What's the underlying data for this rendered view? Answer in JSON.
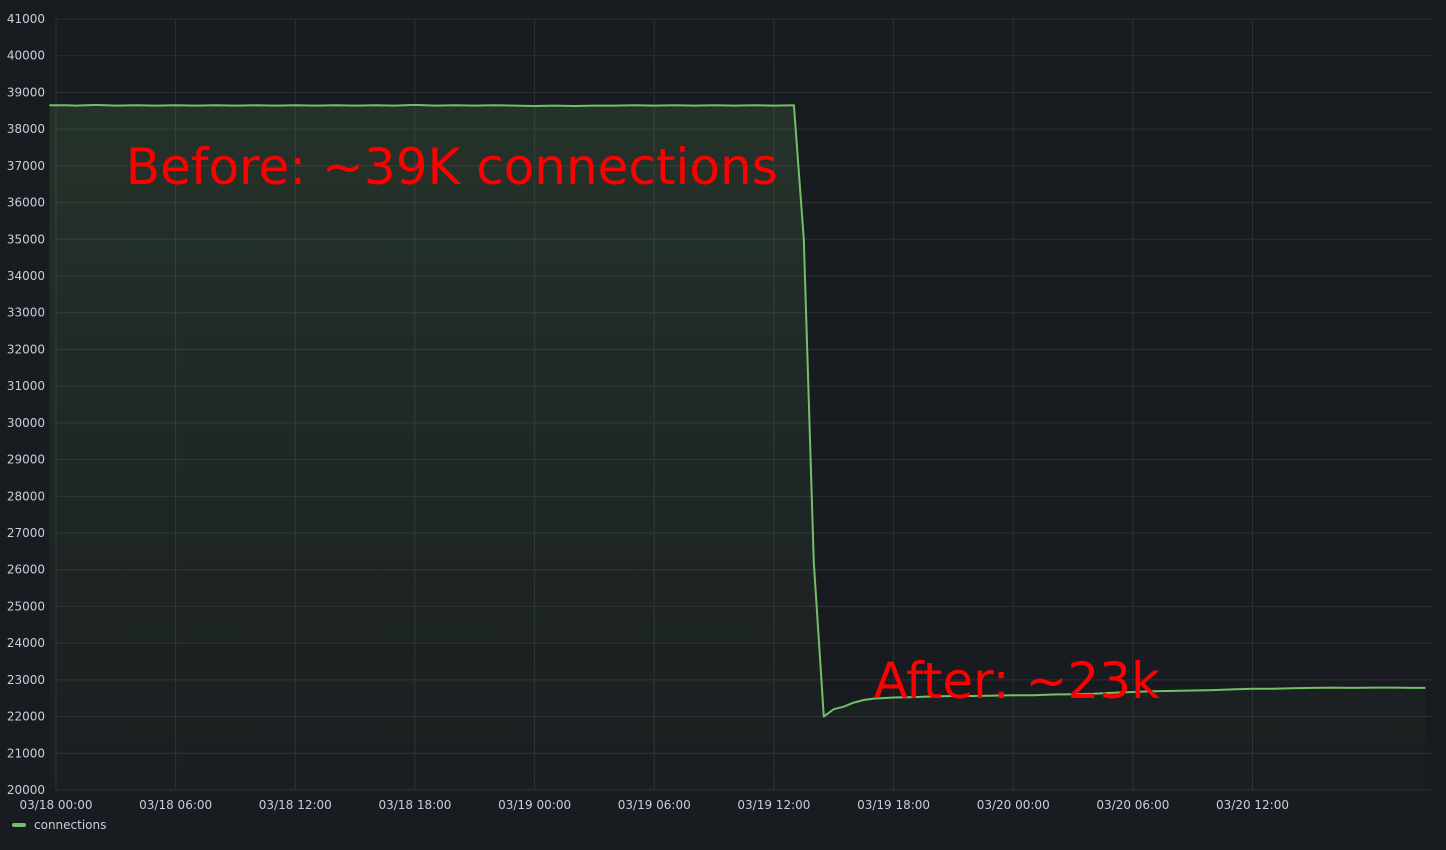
{
  "chart_data": {
    "type": "area",
    "title": "",
    "xlabel": "",
    "ylabel": "",
    "ylim": [
      20000,
      41000
    ],
    "yticks": [
      20000,
      21000,
      22000,
      23000,
      24000,
      25000,
      26000,
      27000,
      28000,
      29000,
      30000,
      31000,
      32000,
      33000,
      34000,
      35000,
      36000,
      37000,
      38000,
      39000,
      40000,
      41000
    ],
    "xlim": [
      "03/18 00:00",
      "03/20 21:00"
    ],
    "xticks": [
      "03/18 00:00",
      "03/18 06:00",
      "03/18 12:00",
      "03/18 18:00",
      "03/19 00:00",
      "03/19 06:00",
      "03/19 12:00",
      "03/19 18:00",
      "03/20 00:00",
      "03/20 06:00",
      "03/20 12:00"
    ],
    "grid": true,
    "legend_position": "bottom-left",
    "series": [
      {
        "name": "connections",
        "color": "#73bf69",
        "x": [
          "03/17 23:40",
          "03/18 00:30",
          "03/18 01:00",
          "03/18 02:00",
          "03/18 03:00",
          "03/18 04:00",
          "03/18 05:00",
          "03/18 06:00",
          "03/18 07:00",
          "03/18 08:00",
          "03/18 09:00",
          "03/18 10:00",
          "03/18 11:00",
          "03/18 12:00",
          "03/18 13:00",
          "03/18 14:00",
          "03/18 15:00",
          "03/18 16:00",
          "03/18 17:00",
          "03/18 18:00",
          "03/18 19:00",
          "03/18 20:00",
          "03/18 21:00",
          "03/18 22:00",
          "03/18 23:00",
          "03/19 00:00",
          "03/19 01:00",
          "03/19 02:00",
          "03/19 03:00",
          "03/19 04:00",
          "03/19 05:00",
          "03/19 06:00",
          "03/19 07:00",
          "03/19 08:00",
          "03/19 09:00",
          "03/19 10:00",
          "03/19 11:00",
          "03/19 12:00",
          "03/19 13:00",
          "03/19 13:30",
          "03/19 14:00",
          "03/19 14:30",
          "03/19 15:00",
          "03/19 15:30",
          "03/19 16:00",
          "03/19 16:30",
          "03/19 17:00",
          "03/19 18:00",
          "03/19 19:00",
          "03/19 20:00",
          "03/19 21:00",
          "03/19 22:00",
          "03/19 23:00",
          "03/20 00:00",
          "03/20 01:00",
          "03/20 02:00",
          "03/20 03:00",
          "03/20 04:00",
          "03/20 05:00",
          "03/20 06:00",
          "03/20 07:00",
          "03/20 08:00",
          "03/20 09:00",
          "03/20 10:00",
          "03/20 11:00",
          "03/20 12:00",
          "03/20 13:00",
          "03/20 14:00",
          "03/20 15:00",
          "03/20 16:00",
          "03/20 17:00",
          "03/20 18:00",
          "03/20 19:00",
          "03/20 20:00",
          "03/20 20:40"
        ],
        "values": [
          38650,
          38650,
          38640,
          38660,
          38640,
          38650,
          38640,
          38650,
          38640,
          38650,
          38640,
          38650,
          38640,
          38650,
          38640,
          38650,
          38640,
          38650,
          38640,
          38660,
          38640,
          38650,
          38640,
          38650,
          38640,
          38630,
          38640,
          38630,
          38640,
          38640,
          38650,
          38640,
          38650,
          38640,
          38650,
          38640,
          38650,
          38640,
          38650,
          35000,
          26200,
          22000,
          22200,
          22270,
          22380,
          22450,
          22490,
          22520,
          22530,
          22550,
          22560,
          22560,
          22570,
          22580,
          22580,
          22600,
          22610,
          22620,
          22650,
          22670,
          22690,
          22700,
          22710,
          22720,
          22740,
          22760,
          22760,
          22770,
          22780,
          22790,
          22780,
          22790,
          22790,
          22780,
          22780
        ]
      }
    ],
    "annotations": [
      {
        "text": "Before: ~39K connections",
        "x": "03/18 03:30",
        "y": 37000
      },
      {
        "text": "After: ~23k",
        "x": "03/19 17:00",
        "y": 23000
      }
    ]
  }
}
